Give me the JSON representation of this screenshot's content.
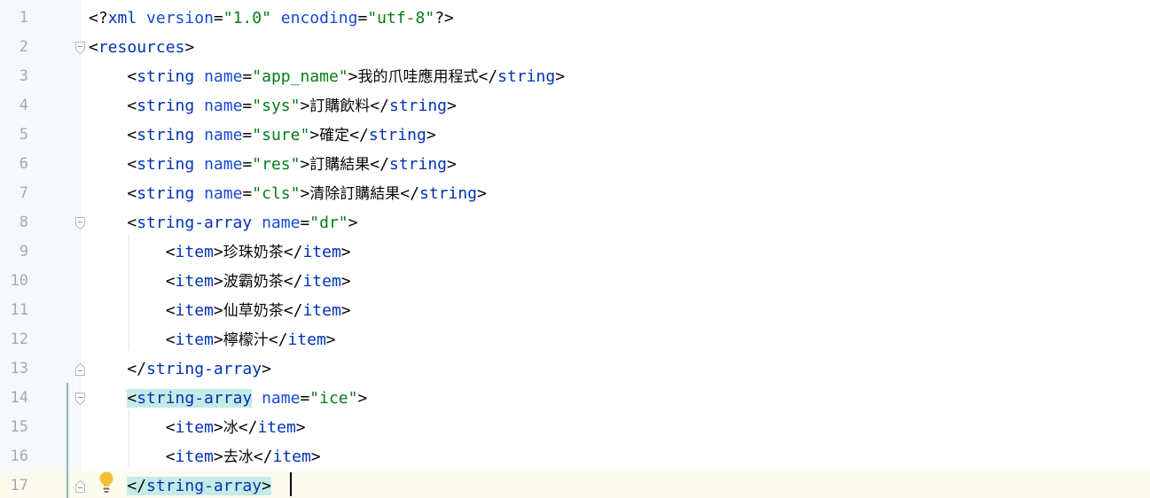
{
  "editor": {
    "language": "xml",
    "current_line": 17,
    "lines": [
      {
        "num": "1",
        "tokens": [
          [
            "pn",
            "<?"
          ],
          [
            "tg",
            "xml"
          ],
          [
            "pn",
            " "
          ],
          [
            "at",
            "version"
          ],
          [
            "pn",
            "="
          ],
          [
            "vl",
            "\"1.0\""
          ],
          [
            "pn",
            " "
          ],
          [
            "at",
            "encoding"
          ],
          [
            "pn",
            "="
          ],
          [
            "vl",
            "\"utf-8\""
          ],
          [
            "pn",
            "?>"
          ]
        ]
      },
      {
        "num": "2",
        "tokens": [
          [
            "pn",
            "<"
          ],
          [
            "tg",
            "resources"
          ],
          [
            "pn",
            ">"
          ]
        ]
      },
      {
        "num": "3",
        "tokens": [
          [
            "pn",
            "    <"
          ],
          [
            "tg",
            "string"
          ],
          [
            "pn",
            " "
          ],
          [
            "at",
            "name"
          ],
          [
            "pn",
            "="
          ],
          [
            "vl",
            "\"app_name\""
          ],
          [
            "pn",
            ">"
          ],
          [
            "cj",
            "我的爪哇應用程式"
          ],
          [
            "pn",
            "</"
          ],
          [
            "tg",
            "string"
          ],
          [
            "pn",
            ">"
          ]
        ]
      },
      {
        "num": "4",
        "tokens": [
          [
            "pn",
            "    <"
          ],
          [
            "tg",
            "string"
          ],
          [
            "pn",
            " "
          ],
          [
            "at",
            "name"
          ],
          [
            "pn",
            "="
          ],
          [
            "vl",
            "\"sys\""
          ],
          [
            "pn",
            ">"
          ],
          [
            "cj",
            "訂購飲料"
          ],
          [
            "pn",
            "</"
          ],
          [
            "tg",
            "string"
          ],
          [
            "pn",
            ">"
          ]
        ]
      },
      {
        "num": "5",
        "tokens": [
          [
            "pn",
            "    <"
          ],
          [
            "tg",
            "string"
          ],
          [
            "pn",
            " "
          ],
          [
            "at",
            "name"
          ],
          [
            "pn",
            "="
          ],
          [
            "vl",
            "\"sure\""
          ],
          [
            "pn",
            ">"
          ],
          [
            "cj",
            "確定"
          ],
          [
            "pn",
            "</"
          ],
          [
            "tg",
            "string"
          ],
          [
            "pn",
            ">"
          ]
        ]
      },
      {
        "num": "6",
        "tokens": [
          [
            "pn",
            "    <"
          ],
          [
            "tg",
            "string"
          ],
          [
            "pn",
            " "
          ],
          [
            "at",
            "name"
          ],
          [
            "pn",
            "="
          ],
          [
            "vl",
            "\"res\""
          ],
          [
            "pn",
            ">"
          ],
          [
            "cj",
            "訂購結果"
          ],
          [
            "pn",
            "</"
          ],
          [
            "tg",
            "string"
          ],
          [
            "pn",
            ">"
          ]
        ]
      },
      {
        "num": "7",
        "tokens": [
          [
            "pn",
            "    <"
          ],
          [
            "tg",
            "string"
          ],
          [
            "pn",
            " "
          ],
          [
            "at",
            "name"
          ],
          [
            "pn",
            "="
          ],
          [
            "vl",
            "\"cls\""
          ],
          [
            "pn",
            ">"
          ],
          [
            "cj",
            "清除訂購結果"
          ],
          [
            "pn",
            "</"
          ],
          [
            "tg",
            "string"
          ],
          [
            "pn",
            ">"
          ]
        ]
      },
      {
        "num": "8",
        "tokens": [
          [
            "pn",
            "    <"
          ],
          [
            "tg",
            "string-array"
          ],
          [
            "pn",
            " "
          ],
          [
            "at",
            "name"
          ],
          [
            "pn",
            "="
          ],
          [
            "vl",
            "\"dr\""
          ],
          [
            "pn",
            ">"
          ]
        ]
      },
      {
        "num": "9",
        "tokens": [
          [
            "pn",
            "        <"
          ],
          [
            "tg",
            "item"
          ],
          [
            "pn",
            ">"
          ],
          [
            "cj",
            "珍珠奶茶"
          ],
          [
            "pn",
            "</"
          ],
          [
            "tg",
            "item"
          ],
          [
            "pn",
            ">"
          ]
        ]
      },
      {
        "num": "10",
        "tokens": [
          [
            "pn",
            "        <"
          ],
          [
            "tg",
            "item"
          ],
          [
            "pn",
            ">"
          ],
          [
            "cj",
            "波霸奶茶"
          ],
          [
            "pn",
            "</"
          ],
          [
            "tg",
            "item"
          ],
          [
            "pn",
            ">"
          ]
        ]
      },
      {
        "num": "11",
        "tokens": [
          [
            "pn",
            "        <"
          ],
          [
            "tg",
            "item"
          ],
          [
            "pn",
            ">"
          ],
          [
            "cj",
            "仙草奶茶"
          ],
          [
            "pn",
            "</"
          ],
          [
            "tg",
            "item"
          ],
          [
            "pn",
            ">"
          ]
        ]
      },
      {
        "num": "12",
        "tokens": [
          [
            "pn",
            "        <"
          ],
          [
            "tg",
            "item"
          ],
          [
            "pn",
            ">"
          ],
          [
            "cj",
            "檸檬汁"
          ],
          [
            "pn",
            "</"
          ],
          [
            "tg",
            "item"
          ],
          [
            "pn",
            ">"
          ]
        ]
      },
      {
        "num": "13",
        "tokens": [
          [
            "pn",
            "    </"
          ],
          [
            "tg",
            "string-array"
          ],
          [
            "pn",
            ">"
          ]
        ]
      },
      {
        "num": "14",
        "tokens": [
          [
            "pn",
            "    "
          ],
          [
            "pn hl",
            "<"
          ],
          [
            "tg hl",
            "string-array"
          ],
          [
            "pn",
            " "
          ],
          [
            "at",
            "name"
          ],
          [
            "pn",
            "="
          ],
          [
            "vl",
            "\"ice\""
          ],
          [
            "pn",
            ">"
          ]
        ]
      },
      {
        "num": "15",
        "tokens": [
          [
            "pn",
            "        <"
          ],
          [
            "tg",
            "item"
          ],
          [
            "pn",
            ">"
          ],
          [
            "cj",
            "冰"
          ],
          [
            "pn",
            "</"
          ],
          [
            "tg",
            "item"
          ],
          [
            "pn",
            ">"
          ]
        ]
      },
      {
        "num": "16",
        "tokens": [
          [
            "pn",
            "        <"
          ],
          [
            "tg",
            "item"
          ],
          [
            "pn",
            ">"
          ],
          [
            "cj",
            "去冰"
          ],
          [
            "pn",
            "</"
          ],
          [
            "tg",
            "item"
          ],
          [
            "pn",
            ">"
          ]
        ]
      },
      {
        "num": "17",
        "tokens": [
          [
            "pn",
            "    "
          ],
          [
            "pn hl",
            "</"
          ],
          [
            "tg hl",
            "string-array"
          ],
          [
            "pn hl",
            ">"
          ]
        ]
      }
    ]
  },
  "icons": {
    "fold_open": "fold-open-icon",
    "fold_close": "fold-close-icon",
    "intention": "lightbulb-icon"
  },
  "colors": {
    "tag": "#0033b3",
    "attribute": "#174ad4",
    "value": "#067d17",
    "text": "#080808",
    "line_number": "#a6a9b0",
    "current_line_bg": "#fcfaed",
    "tag_match_bg": "#c5ebe6"
  }
}
